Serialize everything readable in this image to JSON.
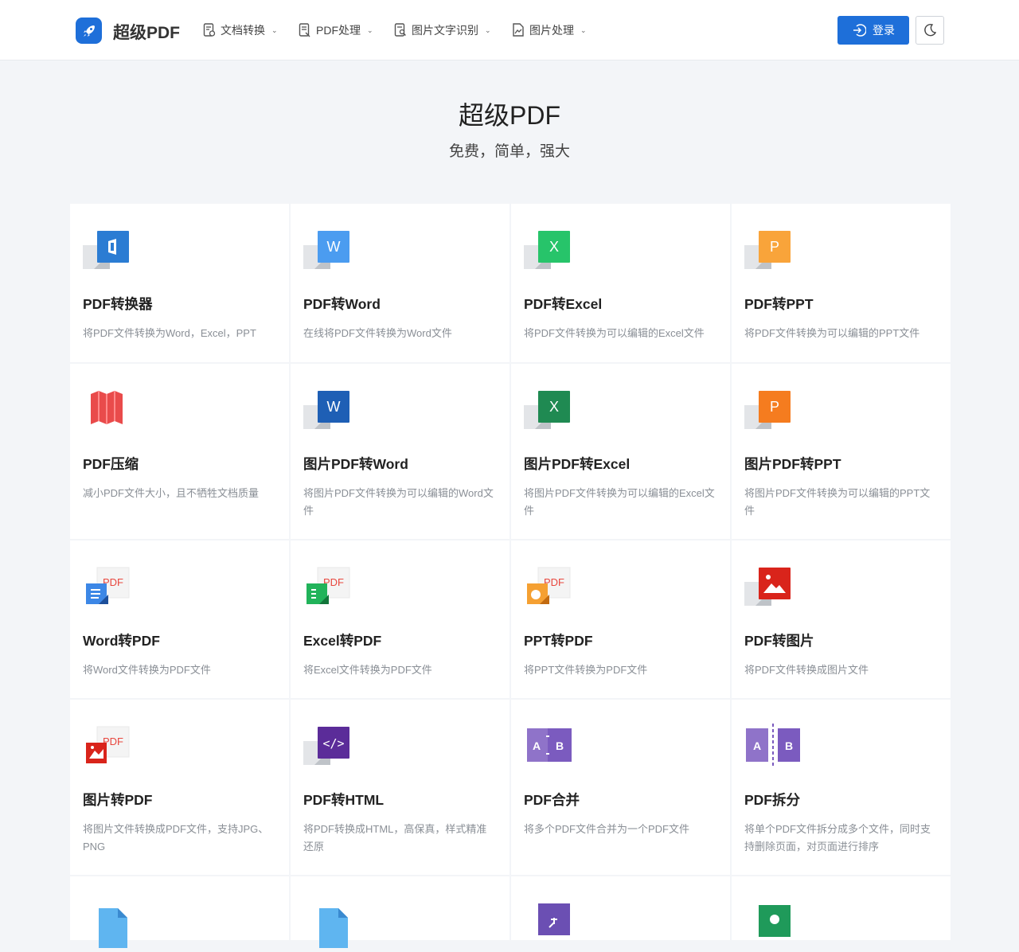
{
  "header": {
    "brand": "超级PDF",
    "nav": [
      {
        "label": "文档转换",
        "icon": "doc-convert-icon"
      },
      {
        "label": "PDF处理",
        "icon": "pdf-process-icon"
      },
      {
        "label": "图片文字识别",
        "icon": "ocr-icon"
      },
      {
        "label": "图片处理",
        "icon": "image-process-icon"
      }
    ],
    "login_label": "登录"
  },
  "hero": {
    "title": "超级PDF",
    "subtitle": "免费，简单，强大"
  },
  "tools": [
    {
      "title": "PDF转换器",
      "desc": "将PDF文件转换为Word，Excel，PPT",
      "icon": "office-icon",
      "color": "#2b7cd3"
    },
    {
      "title": "PDF转Word",
      "desc": "在线将PDF文件转换为Word文件",
      "icon": "word-icon",
      "color": "#4b9cf0"
    },
    {
      "title": "PDF转Excel",
      "desc": "将PDF文件转换为可以编辑的Excel文件",
      "icon": "excel-icon",
      "color": "#27c46a"
    },
    {
      "title": "PDF转PPT",
      "desc": "将PDF文件转换为可以编辑的PPT文件",
      "icon": "ppt-icon",
      "color": "#f9a43a"
    },
    {
      "title": "PDF压缩",
      "desc": "减小PDF文件大小，且不牺牲文档质量",
      "icon": "compress-icon",
      "color": "#e94b4b"
    },
    {
      "title": "图片PDF转Word",
      "desc": "将图片PDF文件转换为可以编辑的Word文件",
      "icon": "word-icon",
      "color": "#1e5fb5"
    },
    {
      "title": "图片PDF转Excel",
      "desc": "将图片PDF文件转换为可以编辑的Excel文件",
      "icon": "excel-icon",
      "color": "#1f8a52"
    },
    {
      "title": "图片PDF转PPT",
      "desc": "将图片PDF文件转换为可以编辑的PPT文件",
      "icon": "ppt-icon",
      "color": "#f57c1f"
    },
    {
      "title": "Word转PDF",
      "desc": "将Word文件转换为PDF文件",
      "icon": "word-to-pdf-icon",
      "color": "#3c87e6"
    },
    {
      "title": "Excel转PDF",
      "desc": "将Excel文件转换为PDF文件",
      "icon": "excel-to-pdf-icon",
      "color": "#21b35a"
    },
    {
      "title": "PPT转PDF",
      "desc": "将PPT文件转换为PDF文件",
      "icon": "ppt-to-pdf-icon",
      "color": "#f5a032"
    },
    {
      "title": "PDF转图片",
      "desc": "将PDF文件转换成图片文件",
      "icon": "pdf-to-image-icon",
      "color": "#d9241b"
    },
    {
      "title": "图片转PDF",
      "desc": "将图片文件转换成PDF文件，支持JPG、PNG",
      "icon": "image-to-pdf-icon",
      "color": "#d9241b"
    },
    {
      "title": "PDF转HTML",
      "desc": "将PDF转换成HTML，高保真，样式精准还原",
      "icon": "html-icon",
      "color": "#5b2c99"
    },
    {
      "title": "PDF合并",
      "desc": "将多个PDF文件合并为一个PDF文件",
      "icon": "merge-icon",
      "color": "#7b5bbf"
    },
    {
      "title": "PDF拆分",
      "desc": "将单个PDF文件拆分成多个文件，同时支持删除页面，对页面进行排序",
      "icon": "split-icon",
      "color": "#7b5bbf"
    }
  ],
  "partial_tools": [
    {
      "icon": "file-x-icon",
      "color": "#5fb5f0"
    },
    {
      "icon": "file-arrow-icon",
      "color": "#5fb5f0"
    },
    {
      "icon": "shrink-icon",
      "color": "#6b4fb3"
    },
    {
      "icon": "pin-icon",
      "color": "#1f9a5a"
    }
  ],
  "icon_text": {
    "pdf": "PDF",
    "W": "W",
    "X": "X",
    "P": "P",
    "A": "A",
    "B": "B"
  }
}
